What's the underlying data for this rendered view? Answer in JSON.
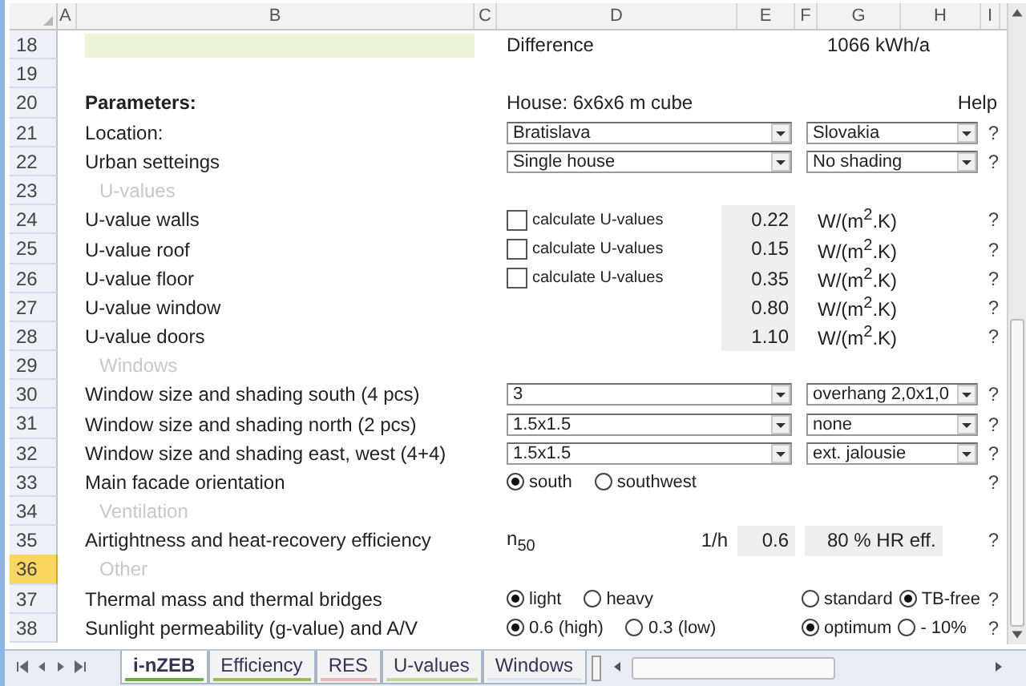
{
  "columns": [
    "A",
    "B",
    "C",
    "D",
    "E",
    "F",
    "G",
    "H",
    "I"
  ],
  "rows": [
    {
      "number": "18",
      "selected": false,
      "kind": "result",
      "difference_label": "Difference",
      "difference_value": "1066 kWh/a"
    },
    {
      "number": "19",
      "selected": false,
      "kind": "blank"
    },
    {
      "number": "20",
      "selected": false,
      "kind": "header",
      "label": "Parameters:",
      "house": "House: 6x6x6 m cube",
      "help": "Help"
    },
    {
      "number": "21",
      "selected": false,
      "kind": "dropdowns",
      "label": "Location:",
      "first": "Bratislava",
      "second": "Slovakia",
      "help": "?"
    },
    {
      "number": "22",
      "selected": false,
      "kind": "dropdowns",
      "label": "Urban setteings",
      "first": "Single house",
      "second": "No shading",
      "help": "?"
    },
    {
      "number": "23",
      "selected": false,
      "kind": "section",
      "label": "U-values"
    },
    {
      "number": "24",
      "selected": false,
      "kind": "uvalue",
      "label": "U-value walls",
      "checkbox": {
        "label": "calculate U-values",
        "checked": false
      },
      "value": "0.22",
      "unit": "W/(m$^{2}$.K)",
      "help": "?"
    },
    {
      "number": "25",
      "selected": false,
      "kind": "uvalue",
      "label": "U-value roof",
      "checkbox": {
        "label": "calculate U-values",
        "checked": false
      },
      "value": "0.15",
      "unit": "W/(m$^{2}$.K)",
      "help": "?"
    },
    {
      "number": "26",
      "selected": false,
      "kind": "uvalue",
      "label": "U-value floor",
      "checkbox": {
        "label": "calculate U-values",
        "checked": false
      },
      "value": "0.35",
      "unit": "W/(m$^{2}$.K)",
      "help": "?"
    },
    {
      "number": "27",
      "selected": false,
      "kind": "uvalue",
      "label": "U-value window",
      "value": "0.80",
      "unit": "W/(m$^{2}$.K)",
      "help": "?"
    },
    {
      "number": "28",
      "selected": false,
      "kind": "uvalue",
      "label": "U-value doors",
      "value": "1.10",
      "unit": "W/(m$^{2}$.K)",
      "help": "?"
    },
    {
      "number": "29",
      "selected": false,
      "kind": "section",
      "label": "Windows"
    },
    {
      "number": "30",
      "selected": false,
      "kind": "dropdowns",
      "label": "Window size and shading south (4 pcs)",
      "first": "3",
      "second": "overhang 2,0x1,0",
      "help": "?"
    },
    {
      "number": "31",
      "selected": false,
      "kind": "dropdowns",
      "label": "Window size and shading north (2 pcs)",
      "first": "1.5x1.5",
      "second": "none",
      "help": "?"
    },
    {
      "number": "32",
      "selected": false,
      "kind": "dropdowns",
      "label": "Window size and shading east, west (4+4)",
      "first": "1.5x1.5",
      "second": "ext. jalousie",
      "help": "?"
    },
    {
      "number": "33",
      "selected": false,
      "kind": "radios",
      "label": "Main facade orientation",
      "options": [
        {
          "label": "south",
          "selected": true
        },
        {
          "label": "southwest",
          "selected": false
        }
      ],
      "help": "?"
    },
    {
      "number": "34",
      "selected": false,
      "kind": "section",
      "label": "Ventilation"
    },
    {
      "number": "35",
      "selected": false,
      "kind": "airtightness",
      "label": "Airtightness and heat-recovery efficiency",
      "symbol": "n$_{50}$",
      "unit": "1/h",
      "value": "0.6",
      "efficiency": "80 % HR eff.",
      "help": "?"
    },
    {
      "number": "36",
      "selected": true,
      "kind": "section",
      "label": "Other"
    },
    {
      "number": "37",
      "selected": false,
      "kind": "radio_pairs",
      "label": "Thermal mass and thermal bridges",
      "options": [
        {
          "label": "light",
          "selected": true
        },
        {
          "label": "heavy",
          "selected": false
        }
      ],
      "options_2": [
        {
          "label": "standard",
          "selected": false
        },
        {
          "label": "TB-free",
          "selected": true
        }
      ],
      "help": "?"
    },
    {
      "number": "38",
      "selected": false,
      "kind": "radio_pairs",
      "label": "Sunlight permeability (g-value) and A/V",
      "options": [
        {
          "label": "0.6 (high)",
          "selected": true
        },
        {
          "label": "0.3 (low)",
          "selected": false
        }
      ],
      "options_2": [
        {
          "label": "optimum",
          "selected": true
        },
        {
          "label": "- 10%",
          "selected": false
        }
      ],
      "help": "?"
    }
  ],
  "sheet_tabs": [
    {
      "label": "i-nZEB",
      "selected": true,
      "color": "#70ad47"
    },
    {
      "label": "Efficiency",
      "selected": false,
      "color": "#9bbb59"
    },
    {
      "label": "RES",
      "selected": false,
      "color": "#e6b8b7"
    },
    {
      "label": "U-values",
      "selected": false,
      "color": "#c4d79b"
    },
    {
      "label": "Windows",
      "selected": false,
      "color": "#dce6f1"
    }
  ]
}
